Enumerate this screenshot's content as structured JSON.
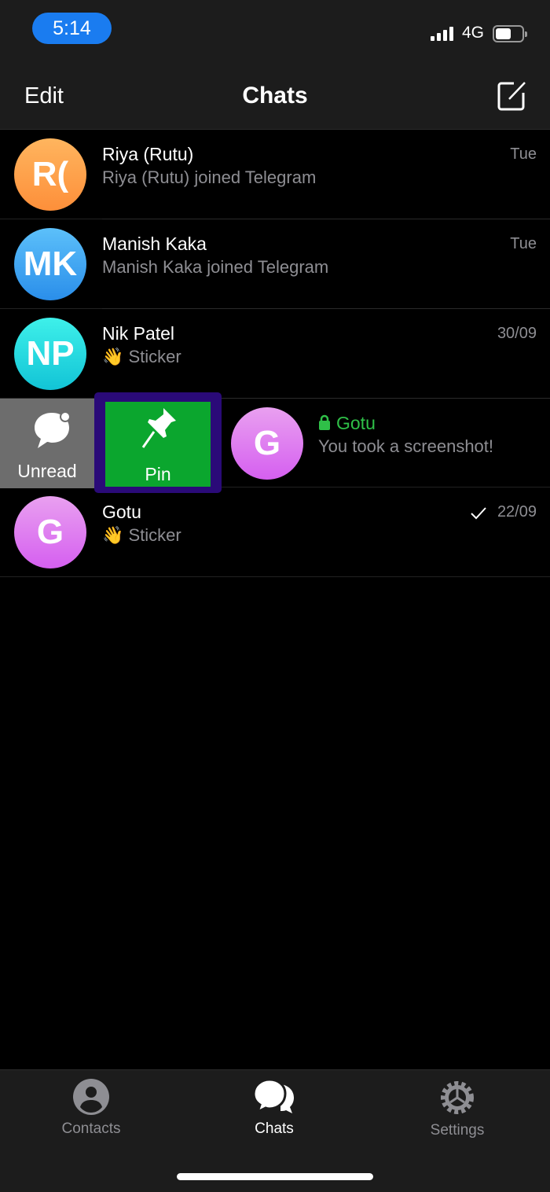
{
  "status_bar": {
    "time": "5:14",
    "network": "4G",
    "battery_percent": 60
  },
  "header": {
    "edit_label": "Edit",
    "title": "Chats",
    "compose_icon": "compose-icon"
  },
  "chats": [
    {
      "initials": "R(",
      "name": "Riya (Rutu)",
      "message": "Riya (Rutu) joined Telegram",
      "date": "Tue",
      "avatar_color": "#fda249"
    },
    {
      "initials": "MK",
      "name": "Manish Kaka",
      "message": "Manish Kaka joined Telegram",
      "date": "Tue",
      "avatar_color": "#3aa5f2"
    },
    {
      "initials": "NP",
      "name": "Nik Patel",
      "message": "👋 Sticker",
      "date": "30/09",
      "avatar_color": "#1fd7d7"
    },
    {
      "initials": "G",
      "name": "Gotu",
      "message": "You took a screenshot!",
      "secret": true,
      "avatar_color": "#d86ff0"
    },
    {
      "initials": "G",
      "name": "Gotu",
      "message": "👋 Sticker",
      "date": "22/09",
      "read": true,
      "avatar_color": "#d86ff0"
    }
  ],
  "swipe_actions": {
    "unread_label": "Unread",
    "pin_label": "Pin",
    "unread_color": "#6d6d6d",
    "pin_color": "#0ba62e",
    "highlight_color": "#2a0a78"
  },
  "tabs": [
    {
      "label": "Contacts",
      "active": false
    },
    {
      "label": "Chats",
      "active": true
    },
    {
      "label": "Settings",
      "active": false
    }
  ],
  "colors": {
    "secret_name": "#2fc048",
    "accent": "#1a7cf0"
  }
}
